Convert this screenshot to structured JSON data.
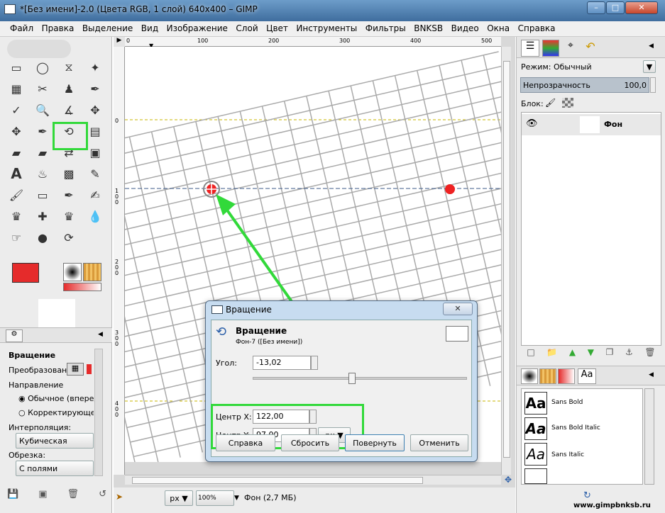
{
  "window": {
    "title": "*[Без имени]-2.0 (Цвета RGB, 1 слой) 640x400 – GIMP"
  },
  "menu": [
    "Файл",
    "Правка",
    "Выделение",
    "Вид",
    "Изображение",
    "Слой",
    "Цвет",
    "Инструменты",
    "Фильтры",
    "BNKSB",
    "Видео",
    "Окна",
    "Справка"
  ],
  "ruler": {
    "h": [
      "0",
      "100",
      "200",
      "300",
      "400",
      "500"
    ],
    "v": [
      "0",
      "1 0 0",
      "2 0 0",
      "3 0 0",
      "4 0 0"
    ]
  },
  "tool_options": {
    "title": "Вращение",
    "transform_label": "Преобразование:",
    "direction_label": "Направление",
    "direction_opts": [
      "Обычное (вперед)",
      "Корректирующее (на"
    ],
    "interp_label": "Интерполяция:",
    "interp_value": "Кубическая",
    "clip_label": "Обрезка:",
    "clip_value": "С полями"
  },
  "status": {
    "unit": "px",
    "zoom": "100%",
    "layer_info": "Фон (2,7 МБ)"
  },
  "layers": {
    "mode_label": "Режим:",
    "mode_value": "Обычный",
    "opacity_label": "Непрозрачность",
    "opacity_value": "100,0",
    "lock_label": "Блок:",
    "layer_name": "Фон"
  },
  "fonts": [
    "Sans Bold",
    "Sans Bold Italic",
    "Sans Italic"
  ],
  "font_tab": "Aa",
  "font_sample": "Aa",
  "dialog": {
    "title": "Вращение",
    "heading": "Вращение",
    "subtitle": "Фон-7 ([Без имени])",
    "angle_label": "Угол:",
    "angle_value": "-13,02",
    "cx_label": "Центр X:",
    "cx_value": "122,00",
    "cy_label": "Центр Y:",
    "cy_value": "97,00",
    "unit": "px",
    "buttons": [
      "Справка",
      "Сбросить",
      "Повернуть",
      "Отменить"
    ]
  },
  "watermark": "www.gimpbnksb.ru",
  "colors": {
    "fg": "#e52b2b",
    "bg": "#ffffff",
    "highlight": "#32d93a"
  }
}
